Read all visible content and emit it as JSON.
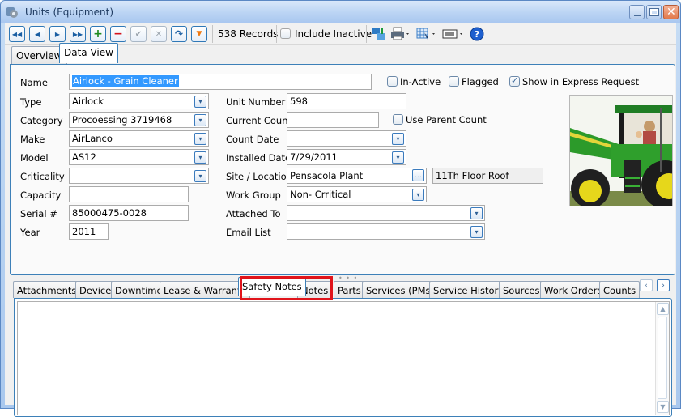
{
  "window": {
    "title": "Units (Equipment)",
    "icons": {
      "app": "gear-database-icon",
      "minimize": "minimize-icon",
      "maximize": "maximize-icon",
      "close": "close-icon"
    }
  },
  "toolbar": {
    "buttons": [
      {
        "name": "first-record",
        "glyph": "⏮"
      },
      {
        "name": "previous-record",
        "glyph": "◂"
      },
      {
        "name": "next-record",
        "glyph": "▸"
      },
      {
        "name": "last-record",
        "glyph": "⏭"
      },
      {
        "name": "add-record",
        "glyph": "+"
      },
      {
        "name": "delete-record",
        "glyph": "−"
      },
      {
        "name": "save-record",
        "glyph": "✔"
      },
      {
        "name": "cancel-edit",
        "glyph": "✕"
      },
      {
        "name": "refresh",
        "glyph": "↷"
      },
      {
        "name": "filter",
        "glyph": "▼"
      }
    ],
    "records": "538 Records",
    "include_inactive": "Include Inactive",
    "include_inactive_checked": false,
    "right_icons": [
      "transfer-icon",
      "print-icon",
      "grid-select-icon",
      "barcode-icon",
      "help-icon"
    ]
  },
  "top_tabs": [
    {
      "label": "Overview",
      "active": false
    },
    {
      "label": "Data View",
      "active": true
    }
  ],
  "form": {
    "name": {
      "label": "Name",
      "value": "Airlock - Grain Cleaner"
    },
    "in_active": {
      "label": "In-Active",
      "checked": false
    },
    "flagged": {
      "label": "Flagged",
      "checked": false
    },
    "show_express": {
      "label": "Show in Express Request",
      "checked": true
    },
    "type": {
      "label": "Type",
      "value": "Airlock"
    },
    "category": {
      "label": "Category",
      "value": "Procoessing 3719468"
    },
    "make": {
      "label": "Make",
      "value": "AirLanco"
    },
    "model": {
      "label": "Model",
      "value": "AS12"
    },
    "criticality": {
      "label": "Criticality",
      "value": ""
    },
    "capacity": {
      "label": "Capacity",
      "value": ""
    },
    "serial": {
      "label": "Serial #",
      "value": "85000475-0028"
    },
    "year": {
      "label": "Year",
      "value": "2011"
    },
    "unit_number": {
      "label": "Unit Number",
      "value": "598"
    },
    "current_count": {
      "label": "Current Count",
      "value": ""
    },
    "use_parent_count": {
      "label": "Use Parent Count",
      "checked": false
    },
    "count_date": {
      "label": "Count Date",
      "value": ""
    },
    "installed_date": {
      "label": "Installed Date",
      "value": "7/29/2011"
    },
    "site_location": {
      "label": "Site / Location",
      "value": "Pensacola Plant",
      "sub_location": "11Th Floor Roof"
    },
    "work_group": {
      "label": "Work Group",
      "value": "Non- Crritical"
    },
    "attached_to": {
      "label": "Attached To",
      "value": ""
    },
    "email_list": {
      "label": "Email List",
      "value": ""
    },
    "photo": "tractor-photo"
  },
  "bottom_tabs": [
    {
      "label": "Attachments",
      "active": false
    },
    {
      "label": "Device",
      "active": false
    },
    {
      "label": "Downtime",
      "active": false
    },
    {
      "label": "Lease & Warranty",
      "active": false
    },
    {
      "label": "Safety Notes",
      "active": true
    },
    {
      "label": "Notes",
      "active": false
    },
    {
      "label": "Parts",
      "active": false
    },
    {
      "label": "Services (PMs)",
      "active": false
    },
    {
      "label": "Service History",
      "active": false
    },
    {
      "label": "Sources",
      "active": false
    },
    {
      "label": "Work Orders",
      "active": false
    },
    {
      "label": "Counts",
      "active": false
    }
  ],
  "safety_notes": {
    "text": ""
  },
  "colors": {
    "accent": "#3d80b8",
    "highlight": "#e0141b",
    "selection": "#3399ff"
  }
}
